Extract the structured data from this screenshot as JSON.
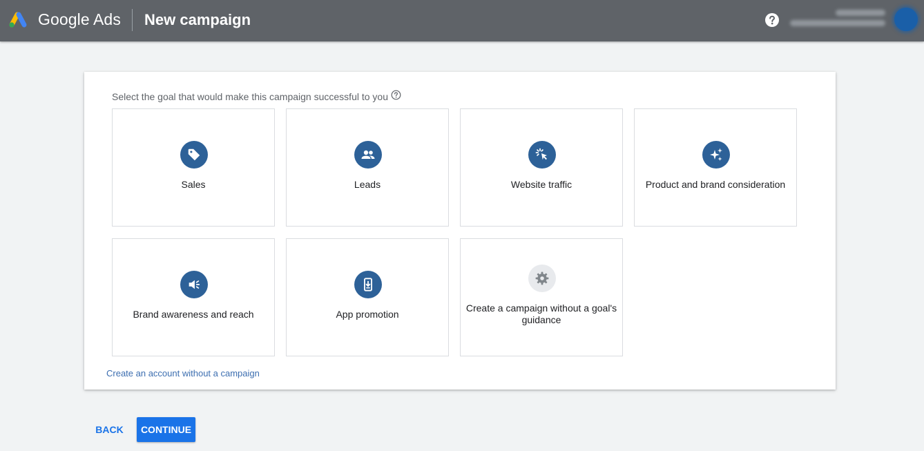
{
  "header": {
    "product_name": "Google Ads",
    "page_title": "New campaign",
    "help_icon": "help-circle-icon",
    "account_icon": "avatar"
  },
  "colors": {
    "topbar": "#5f6368",
    "icon_circle": "#2d6198",
    "primary_button": "#1a73e8",
    "link": "#3c6eb0"
  },
  "main": {
    "prompt": "Select the goal that would make this campaign successful to you",
    "goals": [
      {
        "label": "Sales",
        "icon": "tag-icon"
      },
      {
        "label": "Leads",
        "icon": "people-icon"
      },
      {
        "label": "Website traffic",
        "icon": "cursor-click-icon"
      },
      {
        "label": "Product and brand consideration",
        "icon": "sparkle-icon"
      },
      {
        "label": "Brand awareness and reach",
        "icon": "speaker-icon"
      },
      {
        "label": "App promotion",
        "icon": "phone-download-icon"
      },
      {
        "label": "Create a campaign without a goal's guidance",
        "icon": "gear-icon"
      }
    ],
    "link": "Create an account without a campaign"
  },
  "footer": {
    "back_label": "BACK",
    "continue_label": "CONTINUE"
  }
}
